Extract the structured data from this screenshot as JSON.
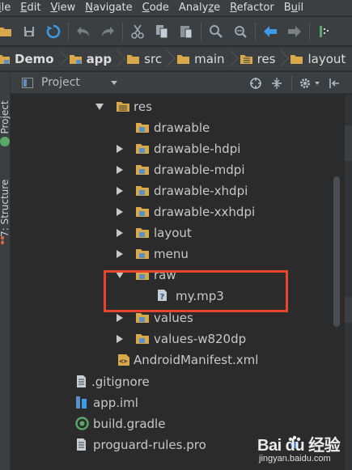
{
  "menu": [
    "ile",
    "Edit",
    "View",
    "Navigate",
    "Code",
    "Analyze",
    "Refactor",
    "Buil"
  ],
  "menu_mnemonics": [
    "i",
    "E",
    "V",
    "N",
    "C",
    "z",
    "R",
    "u"
  ],
  "toolbar": {
    "icons": [
      "open-folder-icon",
      "save-all-icon",
      "sync-icon",
      "undo-icon",
      "redo-icon",
      "cut-icon",
      "copy-icon",
      "paste-icon",
      "find-icon",
      "replace-icon",
      "back-icon",
      "forward-icon",
      "build-icon"
    ]
  },
  "breadcrumb": [
    {
      "label": "Demo",
      "icon": "project-folder-icon",
      "bold": true
    },
    {
      "label": "app",
      "icon": "module-folder-icon",
      "bold": true
    },
    {
      "label": "src",
      "icon": "folder-icon",
      "bold": false
    },
    {
      "label": "main",
      "icon": "folder-icon",
      "bold": false
    },
    {
      "label": "res",
      "icon": "res-folder-icon",
      "bold": false
    },
    {
      "label": "layout",
      "icon": "folder-icon",
      "bold": false
    }
  ],
  "side_tabs": {
    "project": "1: Project",
    "structure": "7: Structure"
  },
  "project_panel": {
    "view_label": "Project"
  },
  "tree": [
    {
      "label": "res",
      "icon": "res-folder-icon",
      "expanded": true,
      "level": 0
    },
    {
      "label": "drawable",
      "icon": "folder-icon",
      "expanded": null,
      "level": 1
    },
    {
      "label": "drawable-hdpi",
      "icon": "folder-icon",
      "expanded": false,
      "level": 1
    },
    {
      "label": "drawable-mdpi",
      "icon": "folder-icon",
      "expanded": false,
      "level": 1
    },
    {
      "label": "drawable-xhdpi",
      "icon": "folder-icon",
      "expanded": false,
      "level": 1
    },
    {
      "label": "drawable-xxhdpi",
      "icon": "folder-icon",
      "expanded": false,
      "level": 1
    },
    {
      "label": "layout",
      "icon": "folder-icon",
      "expanded": false,
      "level": 1
    },
    {
      "label": "menu",
      "icon": "folder-icon",
      "expanded": false,
      "level": 1
    },
    {
      "label": "raw",
      "icon": "folder-icon",
      "expanded": true,
      "level": 1
    },
    {
      "label": "my.mp3",
      "icon": "unknown-file-icon",
      "expanded": null,
      "level": 2
    },
    {
      "label": "values",
      "icon": "folder-icon",
      "expanded": false,
      "level": 1
    },
    {
      "label": "values-w820dp",
      "icon": "folder-icon",
      "expanded": false,
      "level": 1
    },
    {
      "label": "AndroidManifest.xml",
      "icon": "xml-file-icon",
      "expanded": null,
      "level": 0
    },
    {
      "label": ".gitignore",
      "icon": "text-file-icon",
      "expanded": null,
      "level": -1
    },
    {
      "label": "app.iml",
      "icon": "iml-file-icon",
      "expanded": null,
      "level": -1
    },
    {
      "label": "build.gradle",
      "icon": "gradle-file-icon",
      "expanded": null,
      "level": -1
    },
    {
      "label": "proguard-rules.pro",
      "icon": "text-file-icon",
      "expanded": null,
      "level": -1
    }
  ],
  "watermark": {
    "title": "Bai du 经验",
    "url": "jingyan.baidu.com"
  },
  "colors": {
    "background": "#2b2b2b",
    "panel": "#3c3f41",
    "folder": "#d8a94a",
    "res_folder": "#d8a94a",
    "folder_badge": "#5b8fc7",
    "highlight": "#e8452f",
    "text": "#c8c8c8"
  }
}
